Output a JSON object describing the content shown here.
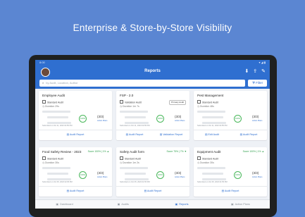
{
  "headline": "Enterprise & Store-by-Store Visibility",
  "status_bar": {
    "time": "8:00",
    "icons": "▾ ◢ ▮"
  },
  "app_bar": {
    "title": "Reports",
    "icons": [
      "download-icon",
      "share-icon",
      "edit-icon"
    ]
  },
  "search": {
    "placeholder": "by Audit, Location, Author",
    "filter_label": "Filter"
  },
  "cards": [
    {
      "title": "Employee Audit",
      "score": "",
      "chip": "",
      "type": "Standard Audit",
      "duration_label": "Duration",
      "duration": "29s",
      "submitted": "Submitted on Oct 11, 2023 04:55 PM",
      "percent": "100%",
      "ratio": "(3/3)",
      "action_plans": "Action Plans",
      "actions": [
        "Audit Report"
      ]
    },
    {
      "title": "FSP - 2.0",
      "score": "",
      "chip": "Primary Audit",
      "type": "Validation Audit",
      "duration_label": "Duration",
      "duration": "1m 7s",
      "submitted": "Submitted on Oct 11, 2023 04:55 PM",
      "percent": "100%",
      "ratio": "(3/3)",
      "action_plans": "Action Plans",
      "actions": [
        "Audit Report",
        "Validation Report"
      ]
    },
    {
      "title": "Pest Management",
      "score": "",
      "chip": "",
      "type": "Standard Audit",
      "duration_label": "Duration",
      "duration": "48s",
      "submitted": "Submitted on Oct 11, 2023 04:55 PM",
      "percent": "100%",
      "ratio": "(3/3)",
      "action_plans": "Action Plans",
      "actions": [
        "Edit Audit",
        "Audit Report"
      ]
    },
    {
      "title": "Food Safety Review - 2023",
      "score": "Score 100% | 1% ▲",
      "chip": "",
      "type": "Standard Audit",
      "duration_label": "Duration",
      "duration": "30s",
      "submitted": "Submitted on Oct 05, 2023 02:05 PM",
      "percent": "100%",
      "ratio": "(3/3)",
      "action_plans": "Action Plans",
      "actions": [
        "Audit Report"
      ]
    },
    {
      "title": "Safety Audit form",
      "score": "Score 75% | 7% ▼",
      "chip": "",
      "type": "Standard Audit",
      "duration_label": "Duration",
      "duration": "1m 2s",
      "submitted": "Submitted on Oct 05, 2023 01:55 PM",
      "percent": "100%",
      "ratio": "(3/3)",
      "action_plans": "Action Plans",
      "actions": [
        "Audit Report"
      ]
    },
    {
      "title": "Equipment Audit",
      "score": "Score 100% | 1% ▲",
      "chip": "",
      "type": "Standard Audit",
      "duration_label": "Duration",
      "duration": "30s",
      "submitted": "Submitted on Oct 05, 2023 01:55 PM",
      "percent": "100%",
      "ratio": "(3/3)",
      "action_plans": "Action Plans",
      "actions": [
        "Audit Report"
      ]
    }
  ],
  "bottom_nav": [
    {
      "label": "Dashboard",
      "icon": "dashboard-icon",
      "active": false
    },
    {
      "label": "Audits",
      "icon": "audits-icon",
      "active": false
    },
    {
      "label": "Reports",
      "icon": "reports-icon",
      "active": true
    },
    {
      "label": "Action Plans",
      "icon": "action-plans-icon",
      "active": false
    }
  ],
  "colors": {
    "background": "#5b86d2",
    "primary": "#2f6fd0",
    "success": "#2e9f4c"
  }
}
